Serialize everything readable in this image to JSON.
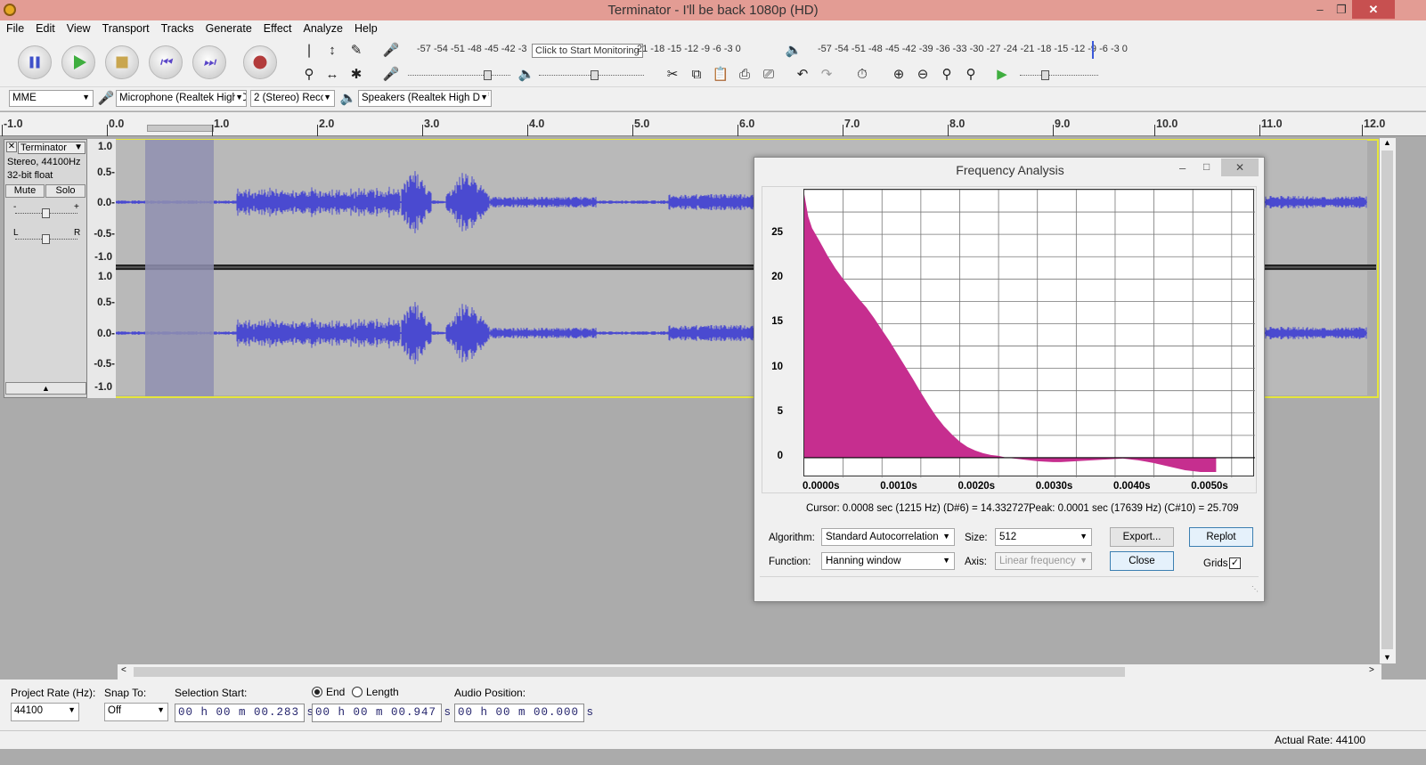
{
  "window": {
    "title": "Terminator - I'll be back 1080p (HD)"
  },
  "menu": [
    "File",
    "Edit",
    "View",
    "Transport",
    "Tracks",
    "Generate",
    "Effect",
    "Analyze",
    "Help"
  ],
  "meters": {
    "record_scale": "-57 -54 -51 -48 -45 -42 -3",
    "record_tooltip": "Click to Start Monitoring",
    "record_scale_tail": "21 -18 -15 -12 -9 -6 -3 0",
    "play_scale": "-57 -54 -51 -48 -45 -42 -39 -36 -33 -30 -27 -24 -21 -18 -15 -12 -9 -6 -3 0",
    "lr_label": "L R"
  },
  "devices": {
    "host": "MME",
    "input": "Microphone (Realtek High D",
    "channels": "2 (Stereo) Reco",
    "output": "Speakers (Realtek High Def"
  },
  "ruler": [
    "-1.0",
    "0.0",
    "1.0",
    "2.0",
    "3.0",
    "4.0",
    "5.0",
    "6.0",
    "7.0",
    "8.0",
    "9.0",
    "10.0",
    "11.0",
    "12.0"
  ],
  "track": {
    "name": "Terminator",
    "format": "Stereo, 44100Hz",
    "bits": "32-bit float",
    "mute": "Mute",
    "solo": "Solo",
    "gain_minus": "-",
    "gain_plus": "+",
    "pan_left": "L",
    "pan_right": "R",
    "scale": [
      "1.0",
      "0.5-",
      "0.0-",
      "-0.5-",
      "-1.0"
    ]
  },
  "bottom": {
    "project_rate_label": "Project Rate (Hz):",
    "project_rate": "44100",
    "snap_label": "Snap To:",
    "snap_value": "Off",
    "selection_start_label": "Selection Start:",
    "selection_start": "00 h 00 m 00.283 s",
    "end_label": "End",
    "length_label": "Length",
    "selection_end": "00 h 00 m 00.947 s",
    "audio_position_label": "Audio Position:",
    "audio_position": "00 h 00 m 00.000 s",
    "actual_rate": "Actual Rate: 44100"
  },
  "dialog": {
    "title": "Frequency Analysis",
    "cursor_text": "Cursor: 0.0008 sec (1215 Hz) (D#6) = 14.332727,",
    "peak_text": "Peak: 0.0001 sec (17639 Hz) (C#10) = 25.709",
    "algorithm_label": "Algorithm:",
    "algorithm": "Standard Autocorrelation",
    "size_label": "Size:",
    "size": "512",
    "function_label": "Function:",
    "function": "Hanning window",
    "axis_label": "Axis:",
    "axis": "Linear frequency",
    "export_button": "Export...",
    "replot_button": "Replot",
    "close_button": "Close",
    "grids_label": "Grids",
    "accent": "#c62e8f"
  },
  "chart_data": {
    "type": "area",
    "x_tick_labels": [
      "0.0000s",
      "0.0010s",
      "0.0020s",
      "0.0030s",
      "0.0040s",
      "0.0050s"
    ],
    "y_tick_labels": [
      "0",
      "5",
      "10",
      "15",
      "20",
      "25"
    ],
    "xlim": [
      0,
      0.0058
    ],
    "ylim": [
      -2.2,
      30
    ],
    "grid": true,
    "series": [
      {
        "x": [
          0.0,
          5e-05,
          0.0001,
          0.0002,
          0.0003,
          0.0004,
          0.0005,
          0.0006,
          0.0007,
          0.0008,
          0.0009,
          0.001,
          0.0011,
          0.0012,
          0.0013,
          0.0014,
          0.0015,
          0.0016,
          0.0017,
          0.0018,
          0.0019,
          0.002,
          0.0021,
          0.0022,
          0.0023,
          0.0024,
          0.0025,
          0.0026,
          0.0027,
          0.0028,
          0.0029,
          0.003,
          0.0031,
          0.0032,
          0.0033,
          0.0034,
          0.0035,
          0.0036,
          0.0037,
          0.0038,
          0.0039,
          0.004,
          0.0041,
          0.0042,
          0.0043,
          0.0044,
          0.0045,
          0.0046,
          0.0047,
          0.0048,
          0.0049,
          0.005,
          0.0051,
          0.0052,
          0.0053
        ],
        "values": [
          29.5,
          27.0,
          25.7,
          24.2,
          22.6,
          21.2,
          20.0,
          18.9,
          17.8,
          16.8,
          15.6,
          14.3,
          13.0,
          11.6,
          10.2,
          8.8,
          7.3,
          5.9,
          4.6,
          3.5,
          2.6,
          1.8,
          1.2,
          0.8,
          0.5,
          0.3,
          0.2,
          0.0,
          -0.1,
          -0.2,
          -0.3,
          -0.4,
          -0.45,
          -0.5,
          -0.5,
          -0.45,
          -0.4,
          -0.35,
          -0.3,
          -0.25,
          -0.2,
          -0.15,
          -0.1,
          -0.2,
          -0.3,
          -0.45,
          -0.6,
          -0.8,
          -1.0,
          -1.2,
          -1.4,
          -1.5,
          -1.6,
          -1.6,
          -1.6
        ]
      }
    ]
  }
}
